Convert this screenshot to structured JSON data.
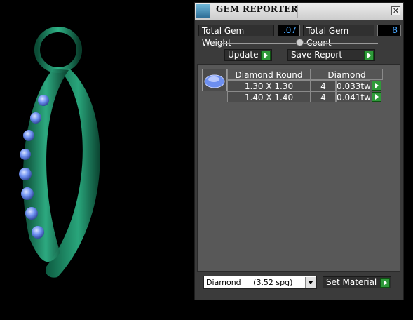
{
  "window": {
    "title": "GEM REPORTER",
    "close_glyph": "✕"
  },
  "summary": {
    "weight_label": "Total Gem Weight",
    "weight_value": ".07",
    "count_label": "Total Gem Count",
    "count_value": "8"
  },
  "toolbar": {
    "update_label": "Update",
    "save_label": "Save Report"
  },
  "report": {
    "headers": [
      "Diamond Round",
      "Diamond"
    ],
    "rows": [
      {
        "size": "1.30 X 1.30",
        "count": "4",
        "weight": "0.033tw"
      },
      {
        "size": "1.40 X 1.40",
        "count": "4",
        "weight": "0.041tw"
      }
    ]
  },
  "material": {
    "selected": "Diamond     (3.52 spg)",
    "set_label": "Set Material"
  },
  "colors": {
    "metal": "#1f8a63",
    "gem": "#6d8ff0",
    "value_text": "#4aa8ff",
    "arrow": "#2f9a3a"
  },
  "icons": [
    "gem-reporter-icon",
    "close-icon",
    "play-arrow-icon",
    "dropdown-arrow-icon",
    "diamond-thumbnail-icon"
  ]
}
